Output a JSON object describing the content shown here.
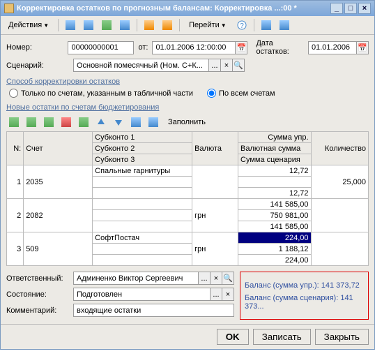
{
  "titlebar": {
    "title": "Корректировка остатков по прогнозным балансам: Корректировка ...:00 *"
  },
  "toolbar": {
    "actions": "Действия",
    "go": "Перейти"
  },
  "form": {
    "number_label": "Номер:",
    "number": "00000000001",
    "from_label": "от:",
    "date": "01.01.2006 12:00:00",
    "balance_date_label": "Дата остатков:",
    "balance_date": "01.01.2006",
    "scenario_label": "Сценарий:",
    "scenario": "Основной помесячный (Ном. С+К..."
  },
  "section1": {
    "title": "Способ корректировки остатков",
    "radio1": "Только по счетам, указанным в табличной части",
    "radio2": "По всем счетам"
  },
  "section2": {
    "title": "Новые остатки по счетам бюджетирования",
    "fill": "Заполнить"
  },
  "grid": {
    "headers": {
      "n": "N:",
      "account": "Счет",
      "sub1": "Субконто 1",
      "sub2": "Субконто 2",
      "sub3": "Субконто 3",
      "currency": "Валюта",
      "amt_mgmt": "Сумма упр.",
      "amt_curr": "Валютная сумма",
      "amt_scen": "Сумма сценария",
      "qty": "Количество"
    },
    "rows": [
      {
        "n": "1",
        "account": "2035",
        "sub": "Спальные гарнитуры",
        "currency": "",
        "a1": "12,72",
        "a2": "",
        "a3": "12,72",
        "qty": "25,000"
      },
      {
        "n": "2",
        "account": "2082",
        "sub": "",
        "currency": "грн",
        "a1": "141 585,00",
        "a2": "750 981,00",
        "a3": "141 585,00",
        "qty": ""
      },
      {
        "n": "3",
        "account": "509",
        "sub": "СофтПостач",
        "currency": "грн",
        "a1": "224,00",
        "a2": "1 188,12",
        "a3": "224,00",
        "qty": ""
      }
    ]
  },
  "bottom": {
    "responsible_label": "Ответственный:",
    "responsible": "Админенко Виктор Сергеевич",
    "state_label": "Состояние:",
    "state": "Подготовлен",
    "comment_label": "Комментарий:",
    "comment": "входящие остатки",
    "balance1": "Баланс (сумма упр.): 141 373,72",
    "balance2": "Баланс (сумма сценария): 141 373..."
  },
  "footer": {
    "ok": "OK",
    "save": "Записать",
    "close": "Закрыть"
  }
}
